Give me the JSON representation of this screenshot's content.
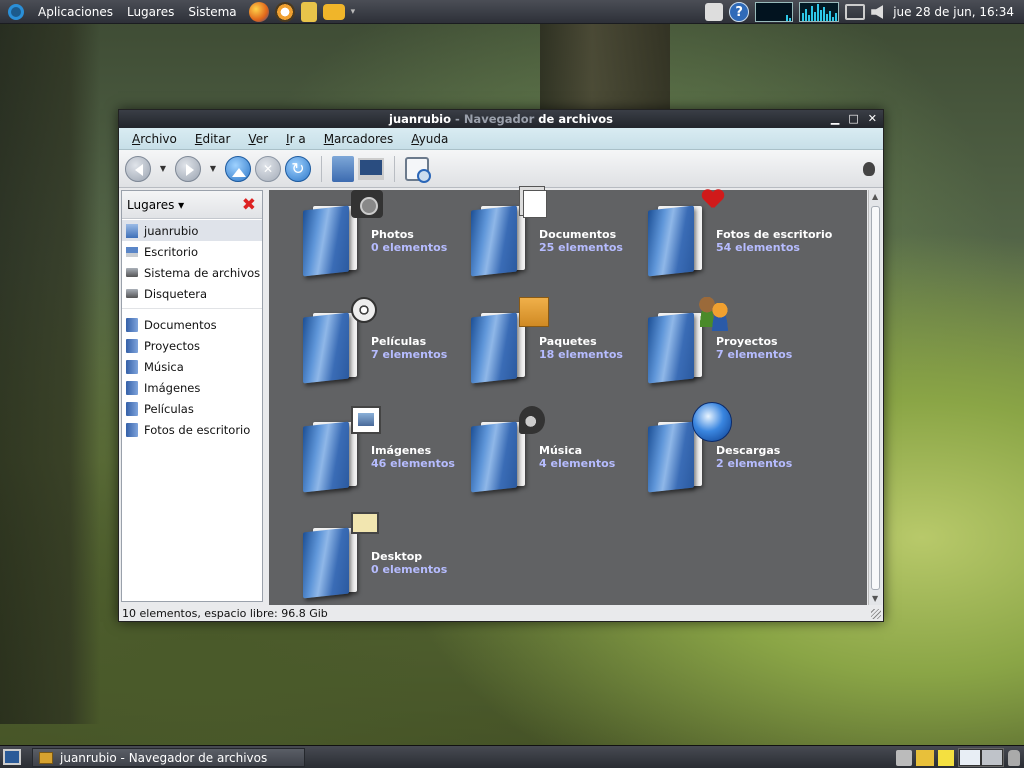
{
  "top_panel": {
    "menus": [
      "Aplicaciones",
      "Lugares",
      "Sistema"
    ],
    "clock": "jue 28 de jun, 16:34",
    "icons": [
      "gnome-foot-icon",
      "firefox-icon",
      "launcher-icon",
      "note-icon",
      "app-icon",
      "help-icon",
      "cpu-monitor",
      "net-monitor",
      "network-icon",
      "volume-icon"
    ]
  },
  "window": {
    "title_user": "juanrubio",
    "title_sep": " - ",
    "title_app": "Navegador",
    "title_rest": " de archivos",
    "menubar": [
      {
        "first": "A",
        "rest": "rchivo"
      },
      {
        "first": "E",
        "rest": "ditar"
      },
      {
        "first": "V",
        "rest": "er"
      },
      {
        "first": "I",
        "rest": "r a"
      },
      {
        "first": "M",
        "rest": "arcadores"
      },
      {
        "first": "A",
        "rest": "yuda"
      }
    ],
    "toolbar_icons": [
      "back-icon",
      "forward-icon",
      "up-icon",
      "stop-icon",
      "reload-icon",
      "home-icon",
      "computer-icon",
      "zoom-icon",
      "throbber-icon"
    ],
    "sidebar": {
      "header": "Lugares ▾",
      "places": [
        {
          "label": "juanrubio",
          "icon": "home",
          "selected": true
        },
        {
          "label": "Escritorio",
          "icon": "desktop"
        },
        {
          "label": "Sistema de archivos",
          "icon": "drive"
        },
        {
          "label": "Disquetera",
          "icon": "drive"
        }
      ],
      "bookmarks": [
        {
          "label": "Documentos"
        },
        {
          "label": "Proyectos"
        },
        {
          "label": "Música"
        },
        {
          "label": "Imágenes"
        },
        {
          "label": "Películas"
        },
        {
          "label": "Fotos de escritorio"
        }
      ]
    },
    "folders": [
      {
        "name": "Photos",
        "count": "0 elementos",
        "emblem": "camera"
      },
      {
        "name": "Documentos",
        "count": "25 elementos",
        "emblem": "docs"
      },
      {
        "name": "Fotos de escritorio",
        "count": "54 elementos",
        "emblem": "heart"
      },
      {
        "name": "Películas",
        "count": "7 elementos",
        "emblem": "film"
      },
      {
        "name": "Paquetes",
        "count": "18 elementos",
        "emblem": "box"
      },
      {
        "name": "Proyectos",
        "count": "7 elementos",
        "emblem": "people"
      },
      {
        "name": "Imágenes",
        "count": "46 elementos",
        "emblem": "image"
      },
      {
        "name": "Música",
        "count": "4 elementos",
        "emblem": "music"
      },
      {
        "name": "Descargas",
        "count": "2 elementos",
        "emblem": "globe"
      },
      {
        "name": "Desktop",
        "count": "0 elementos",
        "emblem": "desktop"
      }
    ],
    "statusbar": "10 elementos, espacio libre: 96.8 Gib"
  },
  "taskbar": {
    "task_label": "juanrubio - Navegador de archivos"
  },
  "colors": {
    "folder_label": "#ffffff",
    "folder_count": "#b6bcff",
    "icon_view_bg": "#616264",
    "close_x": "#dd2222"
  }
}
